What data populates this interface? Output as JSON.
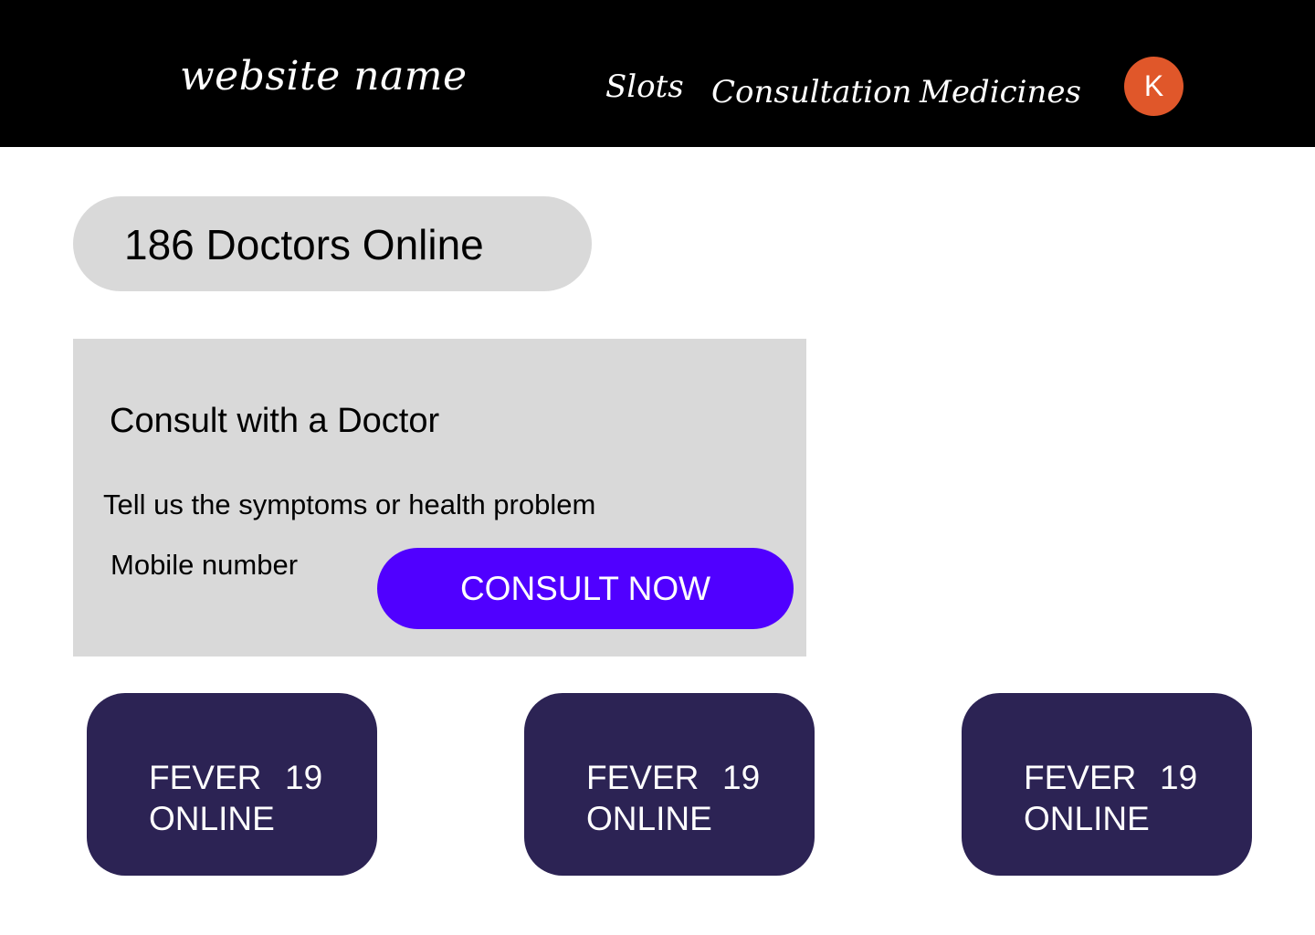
{
  "header": {
    "site_name": "website name",
    "nav": {
      "slots": "Slots",
      "consultation": "Consultation",
      "medicines": "Medicines"
    },
    "avatar_initial": "K"
  },
  "doctors_online": {
    "label": "186 Doctors Online"
  },
  "consult_panel": {
    "title": "Consult with a Doctor",
    "symptoms_placeholder": "Tell us the symptoms or health problem",
    "mobile_placeholder": "Mobile number",
    "button_label": "CONSULT NOW"
  },
  "categories": [
    {
      "name": "FEVER",
      "count": "19",
      "status": "ONLINE"
    },
    {
      "name": "FEVER",
      "count": "19",
      "status": "ONLINE"
    },
    {
      "name": "FEVER",
      "count": "19",
      "status": "ONLINE"
    }
  ],
  "colors": {
    "header_bg": "#000000",
    "avatar_bg": "#e0572a",
    "panel_bg": "#d9d9d9",
    "button_bg": "#5000ff",
    "card_bg": "#2c2354"
  }
}
